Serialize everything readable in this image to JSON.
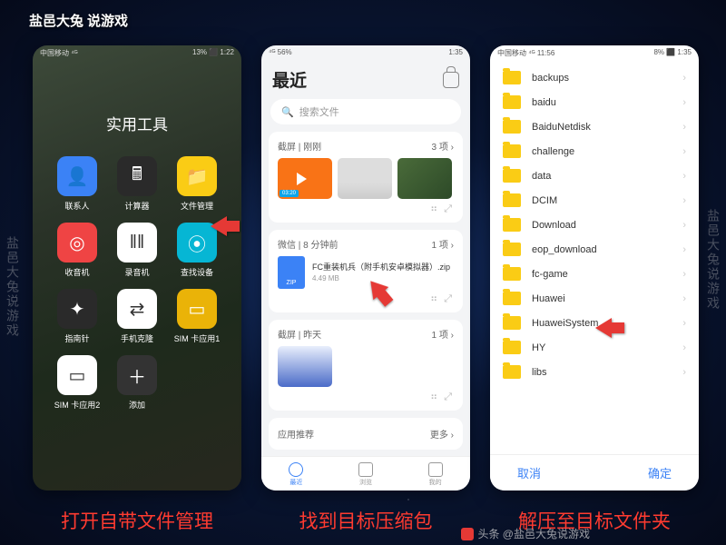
{
  "header": {
    "title": "盐邑大兔",
    "subtitle": "说游戏"
  },
  "watermark": "盐邑大兔说游戏",
  "phone1": {
    "status_left": "中国移动 ⁴ᴳ",
    "status_right": "13% ⬛ 1:22",
    "title": "实用工具",
    "apps": [
      {
        "label": "联系人",
        "cls": "ic-blue",
        "glyph": "👤"
      },
      {
        "label": "计算器",
        "cls": "ic-dark",
        "glyph": "🖩"
      },
      {
        "label": "文件管理",
        "cls": "ic-yellow",
        "glyph": "📁"
      },
      {
        "label": "收音机",
        "cls": "ic-red",
        "glyph": "◎"
      },
      {
        "label": "录音机",
        "cls": "ic-white",
        "glyph": "‖‖"
      },
      {
        "label": "查找设备",
        "cls": "ic-teal",
        "glyph": "⦿"
      },
      {
        "label": "指南针",
        "cls": "ic-dark",
        "glyph": "✦"
      },
      {
        "label": "手机克隆",
        "cls": "ic-white",
        "glyph": "⇄"
      },
      {
        "label": "SIM 卡应用1",
        "cls": "ic-yellow2",
        "glyph": "▭"
      },
      {
        "label": "SIM 卡应用2",
        "cls": "ic-white",
        "glyph": "▭"
      },
      {
        "label": "添加",
        "cls": "ic-plus",
        "glyph": "＋"
      }
    ]
  },
  "phone2": {
    "status_left": "⁴ᴳ 56%",
    "status_right": "1:35",
    "title": "最近",
    "search_placeholder": "搜索文件",
    "card1": {
      "title": "截屏 | 刚刚",
      "count": "3 项 ›",
      "duration": "03:20"
    },
    "card2": {
      "title": "微信 | 8 分钟前",
      "count": "1 项 ›",
      "filename": "FC重装机兵（附手机安卓模拟器）.zip",
      "filesize": "4.49 MB",
      "zip_label": "ZIP"
    },
    "card3": {
      "title": "截屏 | 昨天",
      "count": "1 项 ›"
    },
    "card4": {
      "title": "应用推荐",
      "more": "更多 ›"
    },
    "nav": [
      {
        "label": "最近",
        "active": true
      },
      {
        "label": "浏览",
        "active": false
      },
      {
        "label": "我的",
        "active": false
      }
    ]
  },
  "phone3": {
    "status_left": "中国移动 ⁴ᴳ 11:56",
    "status_right": "8% ⬛ 1:35",
    "folders": [
      "backups",
      "baidu",
      "BaiduNetdisk",
      "challenge",
      "data",
      "DCIM",
      "Download",
      "eop_download",
      "fc-game",
      "Huawei",
      "HuaweiSystem",
      "HY",
      "libs"
    ],
    "cancel": "取消",
    "confirm": "确定"
  },
  "captions": [
    "打开自带文件管理",
    "找到目标压缩包",
    "解压至目标文件夹"
  ],
  "credit": "头条 @盐邑大兔说游戏"
}
